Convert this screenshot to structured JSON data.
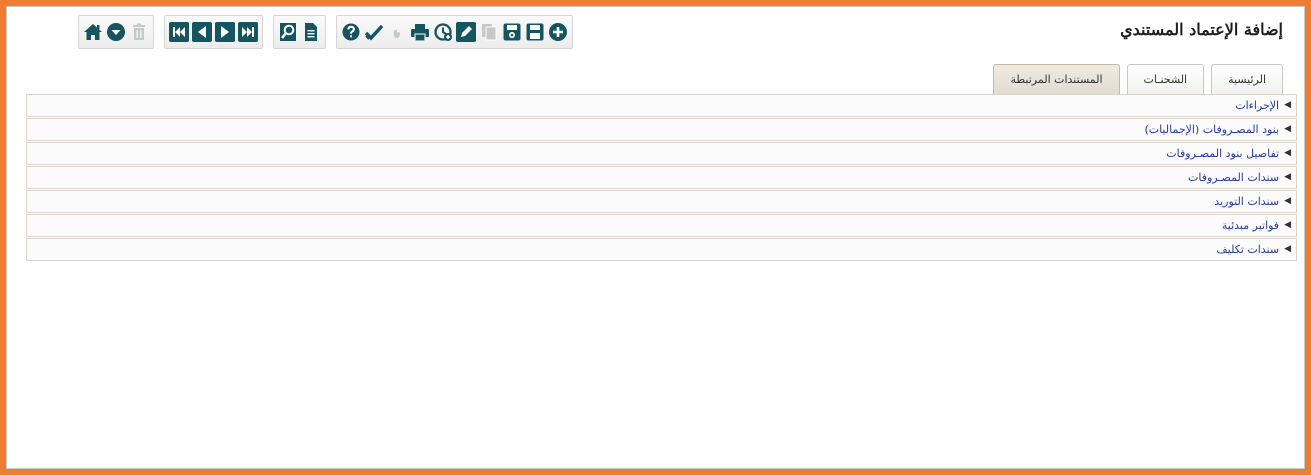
{
  "page": {
    "title": "إضافة الإعتماد المستندي"
  },
  "toolbar": {
    "groups": [
      [
        {
          "icon": "home-icon",
          "enabled": true
        },
        {
          "icon": "down-circle-icon",
          "enabled": true
        },
        {
          "icon": "trash-icon",
          "enabled": false
        }
      ],
      [
        {
          "icon": "first-record-icon",
          "enabled": true
        },
        {
          "icon": "previous-record-icon",
          "enabled": true
        },
        {
          "icon": "next-record-icon",
          "enabled": true
        },
        {
          "icon": "last-record-icon",
          "enabled": true
        }
      ],
      [
        {
          "icon": "search-icon",
          "enabled": true
        },
        {
          "icon": "document-icon",
          "enabled": true
        }
      ],
      [
        {
          "icon": "help-icon",
          "enabled": true
        },
        {
          "icon": "approve-check-icon",
          "enabled": true
        },
        {
          "icon": "hand-icon",
          "enabled": false
        },
        {
          "icon": "print-icon",
          "enabled": true
        },
        {
          "icon": "history-icon",
          "enabled": true
        },
        {
          "icon": "edit-icon",
          "enabled": true
        },
        {
          "icon": "copy-icon",
          "enabled": false
        },
        {
          "icon": "save-as-icon",
          "enabled": true
        },
        {
          "icon": "save-icon",
          "enabled": true
        },
        {
          "icon": "add-icon",
          "enabled": true
        }
      ]
    ],
    "colors": {
      "accent": "#15555f",
      "disabled": "#c4c9c9",
      "orange_frame": "#ed7d31"
    }
  },
  "tabs": [
    {
      "label": "الرئيسية",
      "active": false
    },
    {
      "label": "الشحنـات",
      "active": false
    },
    {
      "label": "المستندات المرتبطة",
      "active": true
    }
  ],
  "panels": [
    {
      "label": "الإجراءات"
    },
    {
      "label": "بنود المصـروفات (الإجماليات)"
    },
    {
      "label": "تفاصيل بنود المصـروفات"
    },
    {
      "label": "سندات المصـروفات"
    },
    {
      "label": "سندات التوريد"
    },
    {
      "label": "فواتير مبدئية"
    },
    {
      "label": "سندات تكليف"
    }
  ],
  "arrow_glyph": "◀"
}
